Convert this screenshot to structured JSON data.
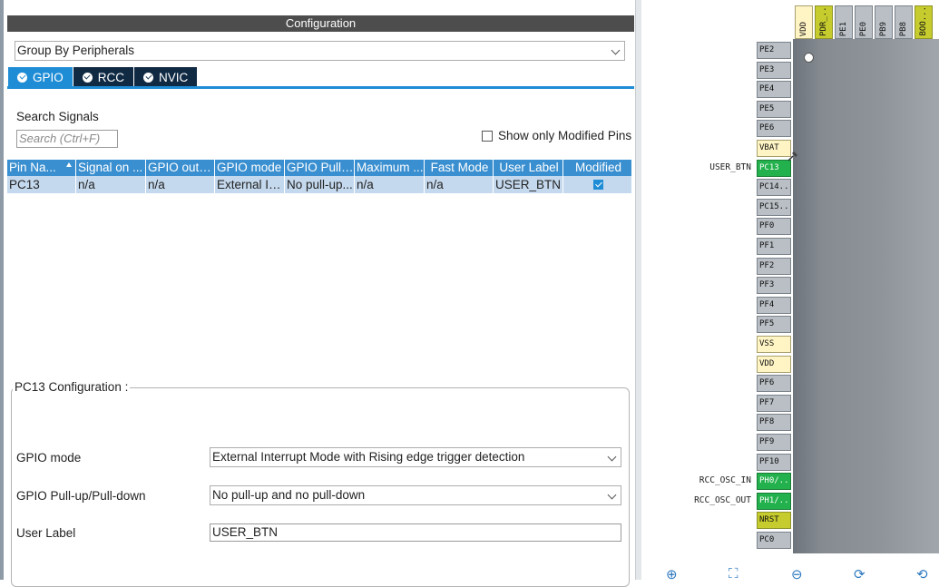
{
  "config": {
    "title": "Configuration",
    "group_by": "Group By Peripherals",
    "tabs": [
      {
        "label": "GPIO",
        "active": true
      },
      {
        "label": "RCC",
        "active": false
      },
      {
        "label": "NVIC",
        "active": false
      }
    ],
    "search_label": "Search Signals",
    "search_placeholder": "Search (Ctrl+F)",
    "show_modified_label": "Show only Modified Pins",
    "table": {
      "columns": [
        "Pin Na...",
        "Signal on ...",
        "GPIO outp...",
        "GPIO mode",
        "GPIO Pull-...",
        "Maximum ...",
        "Fast Mode",
        "User Label",
        "Modified"
      ],
      "rows": [
        [
          "PC13",
          "n/a",
          "n/a",
          "External In...",
          "No pull-up...",
          "n/a",
          "n/a",
          "USER_BTN",
          true
        ]
      ]
    },
    "pin_config": {
      "title": "PC13 Configuration :",
      "gpio_mode_label": "GPIO mode",
      "gpio_mode_value": "External Interrupt Mode with Rising edge trigger detection",
      "pull_label": "GPIO Pull-up/Pull-down",
      "pull_value": "No pull-up and no pull-down",
      "user_label_label": "User Label",
      "user_label_value": "USER_BTN"
    }
  },
  "chip": {
    "top_pins": [
      {
        "name": "VDD",
        "color": "yellow"
      },
      {
        "name": "PDR_...",
        "color": "olive"
      },
      {
        "name": "PE1",
        "color": "gray"
      },
      {
        "name": "PE0",
        "color": "gray"
      },
      {
        "name": "PB9",
        "color": "gray"
      },
      {
        "name": "PB8",
        "color": "gray"
      },
      {
        "name": "BOO...",
        "color": "olive"
      }
    ],
    "left_pins": [
      {
        "name": "PE2",
        "color": "gray"
      },
      {
        "name": "PE3",
        "color": "gray"
      },
      {
        "name": "PE4",
        "color": "gray"
      },
      {
        "name": "PE5",
        "color": "gray"
      },
      {
        "name": "PE6",
        "color": "gray"
      },
      {
        "name": "VBAT",
        "color": "yellow"
      },
      {
        "name": "PC13",
        "color": "green",
        "signal": "USER_BTN"
      },
      {
        "name": "PC14..",
        "color": "gray"
      },
      {
        "name": "PC15..",
        "color": "gray"
      },
      {
        "name": "PF0",
        "color": "gray"
      },
      {
        "name": "PF1",
        "color": "gray"
      },
      {
        "name": "PF2",
        "color": "gray"
      },
      {
        "name": "PF3",
        "color": "gray"
      },
      {
        "name": "PF4",
        "color": "gray"
      },
      {
        "name": "PF5",
        "color": "gray"
      },
      {
        "name": "VSS",
        "color": "yellow"
      },
      {
        "name": "VDD",
        "color": "yellow"
      },
      {
        "name": "PF6",
        "color": "gray"
      },
      {
        "name": "PF7",
        "color": "gray"
      },
      {
        "name": "PF8",
        "color": "gray"
      },
      {
        "name": "PF9",
        "color": "gray"
      },
      {
        "name": "PF10",
        "color": "gray"
      },
      {
        "name": "PH0/..",
        "color": "green",
        "signal": "RCC_OSC_IN"
      },
      {
        "name": "PH1/..",
        "color": "green",
        "signal": "RCC_OSC_OUT"
      },
      {
        "name": "NRST",
        "color": "olive"
      },
      {
        "name": "PC0",
        "color": "gray"
      }
    ],
    "toolbar_icons": [
      "zoom-in-icon",
      "fit-icon",
      "zoom-out-icon",
      "rotate-right-icon",
      "rotate-left-icon"
    ]
  }
}
